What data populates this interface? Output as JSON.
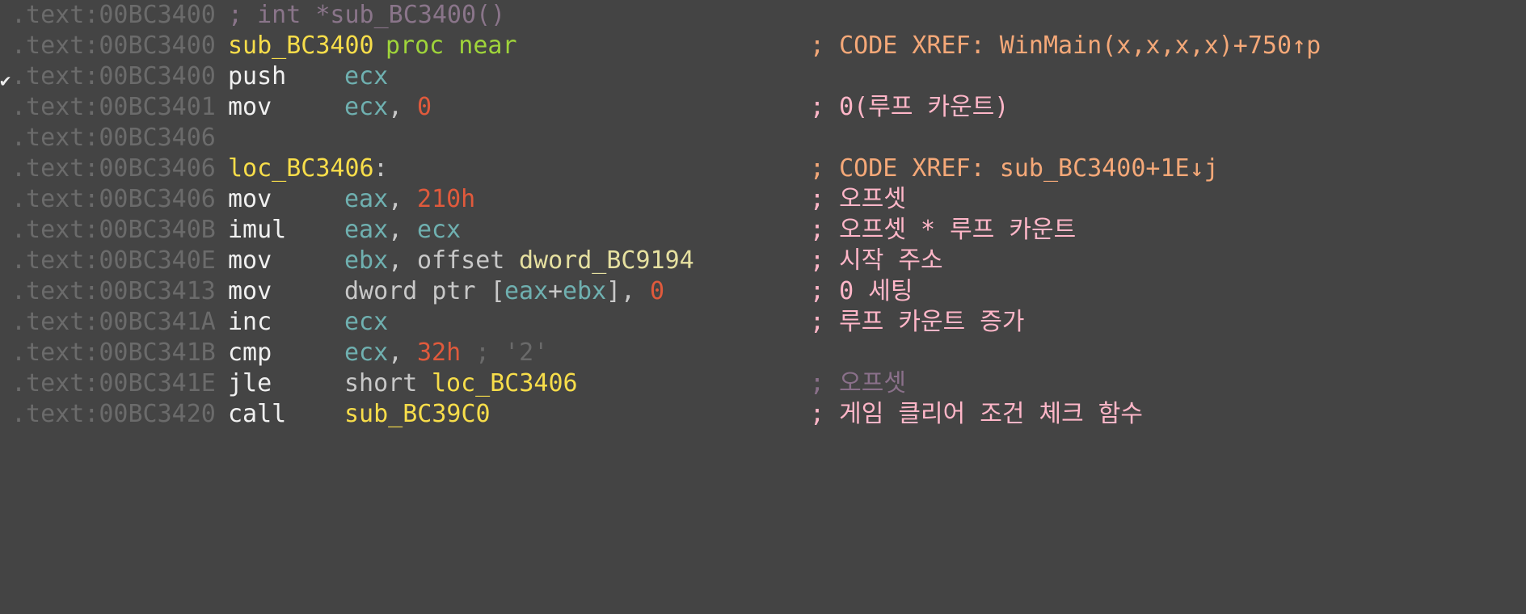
{
  "colors": {
    "background": "#444444",
    "address": "#6b6b6b",
    "label": "#f7dd4a",
    "keyword": "#9fd43a",
    "register": "#6fb0b0",
    "number": "#e05a3c",
    "comment": "#ffb6c8",
    "xref_comment": "#f4a878"
  },
  "lines": [
    {
      "addr": ".text:00BC3400",
      "proto": "; int *sub_BC3400()"
    },
    {
      "addr": ".text:00BC3400",
      "label": "sub_BC3400",
      "kw": "proc near",
      "comment": "; CODE XREF: WinMain(x,x,x,x)+750↑p"
    },
    {
      "addr": ".text:00BC3400",
      "mnemonic": "push",
      "reg1": "ecx"
    },
    {
      "addr": ".text:00BC3401",
      "mnemonic": "mov",
      "reg1": "ecx",
      "comma": ",",
      "num": "0",
      "comment": "; 0(루프 카운트)"
    },
    {
      "addr": ".text:00BC3406"
    },
    {
      "addr": ".text:00BC3406",
      "label": "loc_BC3406",
      "colon": ":",
      "comment": "; CODE XREF: sub_BC3400+1E↓j"
    },
    {
      "addr": ".text:00BC3406",
      "mnemonic": "mov",
      "reg1": "eax",
      "comma": ",",
      "num": "210h",
      "comment": "; 오프셋"
    },
    {
      "addr": ".text:00BC340B",
      "mnemonic": "imul",
      "reg1": "eax",
      "comma": ",",
      "reg2": "ecx",
      "comment": "; 오프셋 * 루프 카운트"
    },
    {
      "addr": ".text:00BC340E",
      "mnemonic": "mov",
      "reg1": "ebx",
      "comma": ",",
      "kwoff": "offset",
      "sym": "dword_BC9194",
      "comment": "; 시작 주소"
    },
    {
      "addr": ".text:00BC3413",
      "mnemonic": "mov",
      "ptr": "dword ptr [",
      "r1": "eax",
      "plus": "+",
      "r2": "ebx",
      "close": "],",
      "num": "0",
      "comment": "; 0 세팅"
    },
    {
      "addr": ".text:00BC341A",
      "mnemonic": "inc",
      "reg1": "ecx",
      "comment": "; 루프 카운트 증가"
    },
    {
      "addr": ".text:00BC341B",
      "mnemonic": "cmp",
      "reg1": "ecx",
      "comma": ",",
      "num": "32h",
      "auto": "; '2'"
    },
    {
      "addr": ".text:00BC341E",
      "mnemonic": "jle",
      "short": "short",
      "jlabel": "loc_BC3406",
      "dimcomment": "; 오프셋"
    },
    {
      "addr": ".text:00BC3420",
      "mnemonic": "call",
      "jlabel": "sub_BC39C0",
      "comment": "; 게임 클리어 조건 체크 함수"
    }
  ]
}
